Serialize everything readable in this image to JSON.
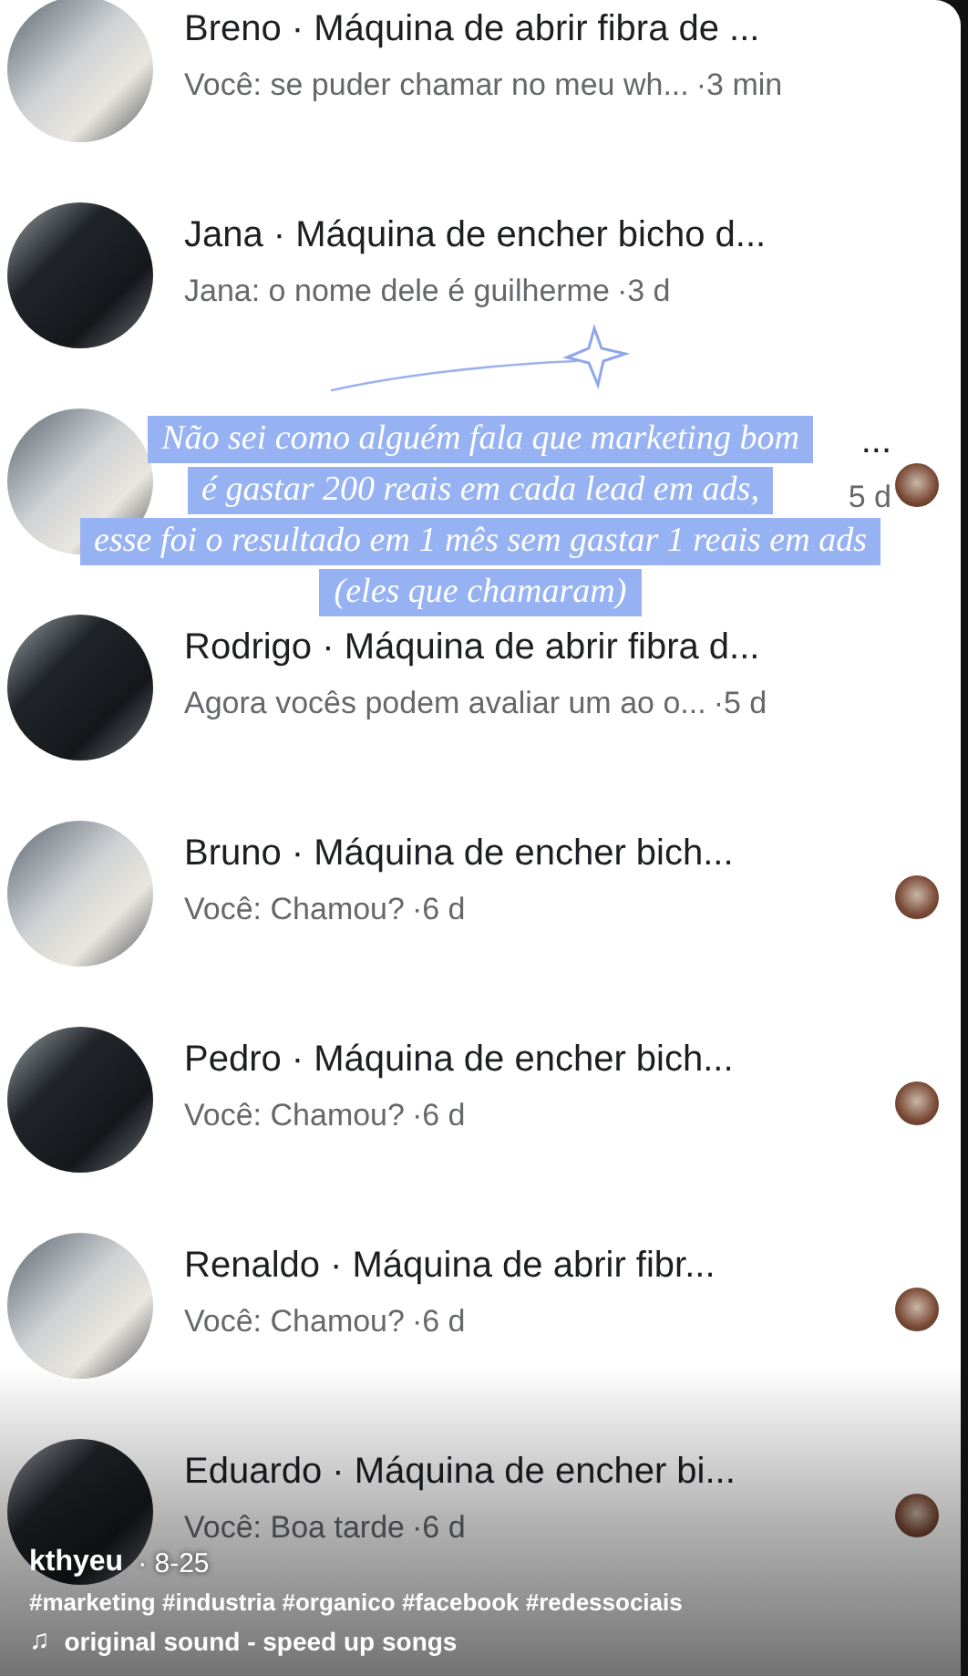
{
  "conversations": [
    {
      "title": "Breno · Máquina de abrir fibra de ...",
      "preview": "Você: se puder chamar no meu wh...",
      "time": "·3 min",
      "covered": false,
      "read_receipt": false
    },
    {
      "title": "Jana · Máquina de encher bicho d...",
      "preview": "Jana: o nome dele é guilherme",
      "time": "·3 d",
      "covered": false,
      "read_receipt": false
    },
    {
      "title": "...",
      "time": "5 d",
      "covered": true,
      "read_receipt": true
    },
    {
      "title": "Rodrigo · Máquina de abrir fibra d...",
      "preview": "Agora vocês podem avaliar um ao o...",
      "time": "·5 d",
      "covered": false,
      "read_receipt": false
    },
    {
      "title": "Bruno · Máquina de encher bich...",
      "preview": "Você: Chamou?",
      "time": "·6 d",
      "covered": false,
      "read_receipt": true
    },
    {
      "title": "Pedro · Máquina de encher bich...",
      "preview": "Você: Chamou?",
      "time": "·6 d",
      "covered": false,
      "read_receipt": true
    },
    {
      "title": "Renaldo · Máquina de abrir fibr...",
      "preview": "Você: Chamou?",
      "time": "·6 d",
      "covered": false,
      "read_receipt": true
    },
    {
      "title": "Eduardo · Máquina de encher bi...",
      "preview": "Você: Boa tarde",
      "time": "·6 d",
      "covered": false,
      "read_receipt": true
    }
  ],
  "caption": {
    "lines": [
      "Não sei como alguém fala que marketing bom",
      "é gastar 200 reais em cada lead em ads,",
      "esse foi o resultado em 1 mês sem gastar 1 reais em ads",
      "(eles que chamaram)"
    ]
  },
  "post": {
    "author": "kthyeu",
    "date": "· 8-25",
    "hashtags": "#marketing #industria #organico #facebook #redessociais",
    "sound_icon": "♫",
    "sound": "original sound - speed up songs"
  }
}
